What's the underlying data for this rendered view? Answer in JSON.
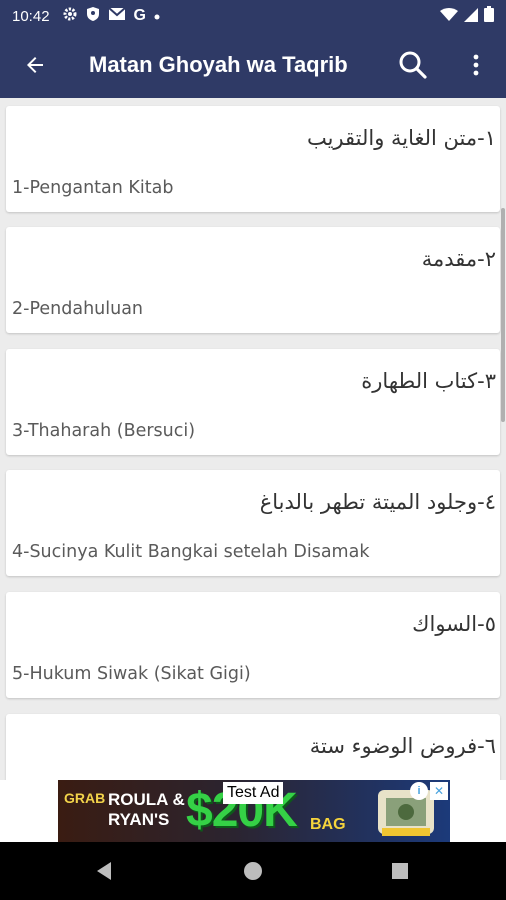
{
  "status_bar": {
    "time": "10:42",
    "left_icons": [
      "gear-icon",
      "shield-icon",
      "mail-icon",
      "google-g-icon",
      "dot-icon"
    ],
    "right_icons": [
      "wifi-icon",
      "signal-icon",
      "battery-icon"
    ],
    "g_letter": "G"
  },
  "app_bar": {
    "title": "Matan Ghoyah wa Taqrib",
    "background": "#2f3a66"
  },
  "items": [
    {
      "arabic": "١-متن الغاية والتقريب",
      "latin": "1-Pengantan Kitab"
    },
    {
      "arabic": "٢-مقدمة",
      "latin": "2-Pendahuluan"
    },
    {
      "arabic": "٣-كتاب الطهارة",
      "latin": "3-Thaharah (Bersuci)"
    },
    {
      "arabic": "٤-وجلود الميتة تطهر بالدباغ",
      "latin": "4-Sucinya Kulit Bangkai setelah Disamak"
    },
    {
      "arabic": "٥-السواك",
      "latin": "5-Hukum Siwak (Sikat Gigi)"
    },
    {
      "arabic": "٦-فروض الوضوء ستة",
      "latin": ""
    }
  ],
  "ad": {
    "grab": "GRAB",
    "names_line1": "ROULA &",
    "names_line2": "RYAN'S",
    "amount": "$20K",
    "bag": "BAG",
    "test_label": "Test Ad",
    "close": "✕",
    "info": "i"
  }
}
